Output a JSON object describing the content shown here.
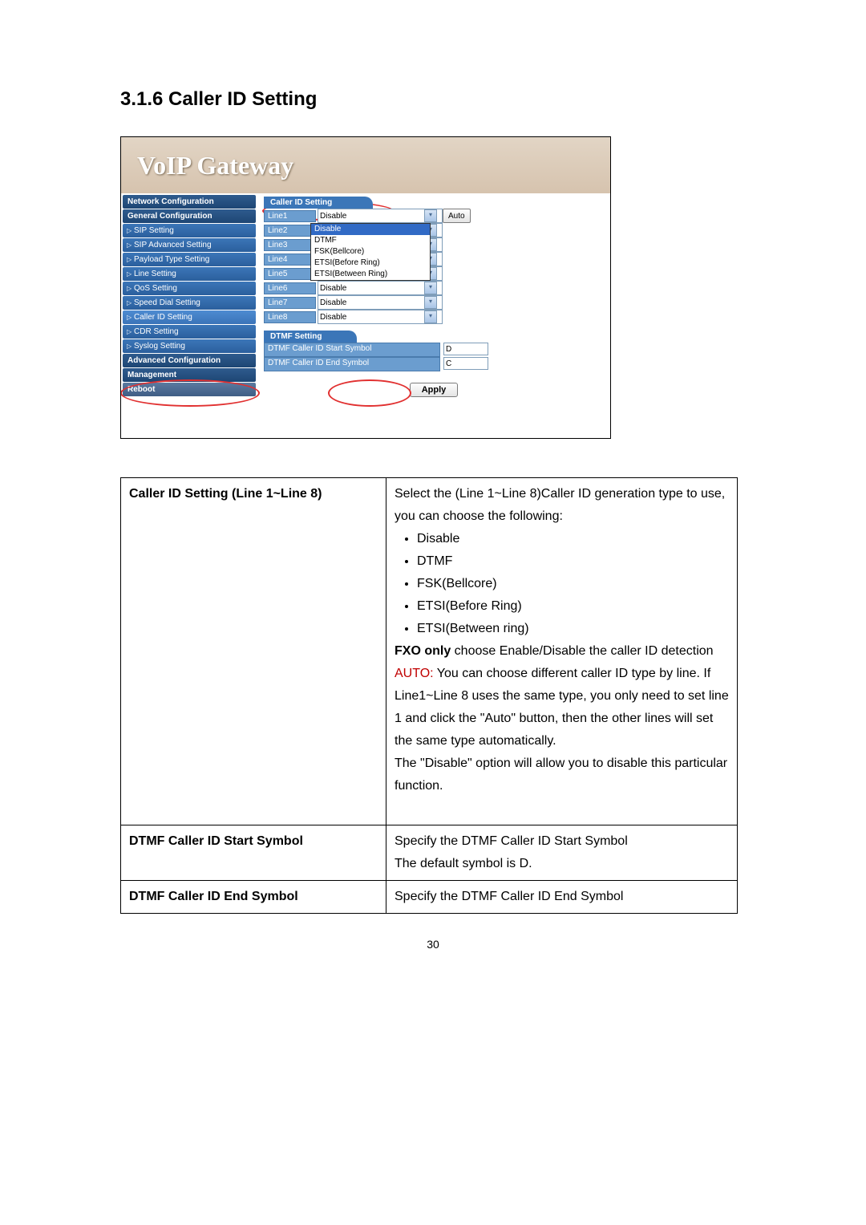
{
  "heading": "3.1.6   Caller ID Setting",
  "banner_title": "VoIP  Gateway",
  "sidebar": {
    "groups": [
      {
        "type": "head",
        "label": "Network Configuration"
      },
      {
        "type": "head",
        "label": "General Configuration"
      },
      {
        "type": "item",
        "label": "SIP Setting"
      },
      {
        "type": "item",
        "label": "SIP Advanced Setting"
      },
      {
        "type": "item",
        "label": "Payload Type Setting"
      },
      {
        "type": "item",
        "label": "Line Setting"
      },
      {
        "type": "item",
        "label": "QoS Setting"
      },
      {
        "type": "item",
        "label": "Speed Dial Setting"
      },
      {
        "type": "item",
        "label": "Caller ID Setting",
        "active": true
      },
      {
        "type": "item",
        "label": "CDR Setting"
      },
      {
        "type": "item",
        "label": "Syslog Setting"
      },
      {
        "type": "head",
        "label": "Advanced Configuration"
      },
      {
        "type": "head",
        "label": "Management"
      },
      {
        "type": "foot",
        "label": "Reboot"
      }
    ]
  },
  "caller_panel_title": "Caller ID Setting",
  "lines": [
    {
      "label": "Line1",
      "value": "Disable",
      "auto": true
    },
    {
      "label": "Line2",
      "value": ""
    },
    {
      "label": "Line3",
      "value": ""
    },
    {
      "label": "Line4",
      "value": ""
    },
    {
      "label": "Line5",
      "value": "Disable"
    },
    {
      "label": "Line6",
      "value": "Disable"
    },
    {
      "label": "Line7",
      "value": "Disable"
    },
    {
      "label": "Line8",
      "value": "Disable"
    }
  ],
  "auto_label": "Auto",
  "dropdown_options": [
    "Disable",
    "DTMF",
    "FSK(Bellcore)",
    "ETSI(Before Ring)",
    "ETSI(Between Ring)"
  ],
  "dtmf_panel_title": "DTMF Setting",
  "dtmf_rows": [
    {
      "label": "DTMF Caller ID Start Symbol",
      "value": "D"
    },
    {
      "label": "DTMF Caller ID End Symbol",
      "value": "C"
    }
  ],
  "apply_label": "Apply",
  "desc": {
    "row1": {
      "title": "Caller ID Setting (Line 1~Line 8)",
      "p1": "Select the (Line 1~Line 8)Caller ID generation type to use, you can choose the following:",
      "opts": [
        "Disable",
        "DTMF",
        "FSK(Bellcore)",
        "ETSI(Before Ring)",
        "ETSI(Between ring)"
      ],
      "p2a": "FXO only",
      "p2b": " choose Enable/Disable the caller ID detection",
      "p3a": "AUTO:",
      "p3b": " You can choose different caller ID type by line.   If Line1~Line 8 uses the same type, you only need to set line 1 and click the \"Auto\" button, then the other lines will set the same type automatically.",
      "p4": "The \"Disable\" option will allow you to disable this particular function."
    },
    "row2": {
      "title": "DTMF Caller ID Start Symbol",
      "p1": "Specify the DTMF Caller ID Start Symbol",
      "p2": "The default symbol is D."
    },
    "row3": {
      "title": "DTMF Caller ID End Symbol",
      "p1": "Specify the DTMF Caller ID End Symbol"
    }
  },
  "page_number": "30"
}
